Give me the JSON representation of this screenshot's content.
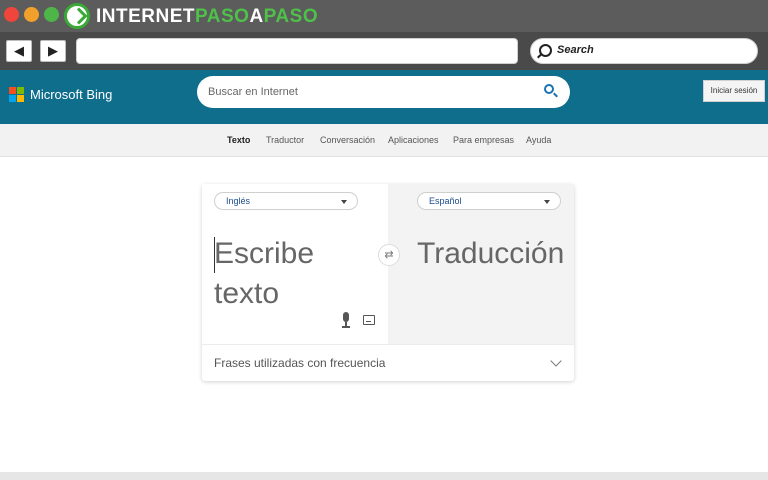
{
  "chrome": {
    "brand_prefix": "INTERNET",
    "brand_accent": "PASO",
    "brand_connector": "A",
    "brand_suffix": "PASO",
    "back_glyph": "◀",
    "forward_glyph": "▶",
    "address_value": "",
    "search_label": "Search",
    "colors": {
      "close": "#f0453a",
      "minimize": "#f2a02c",
      "maximize": "#4eb649",
      "brand_green": "#4fc04a"
    }
  },
  "bing": {
    "title": "Microsoft Bing",
    "search_placeholder": "Buscar en Internet",
    "signin_label": "Iniciar sesión",
    "header_color": "#0f6e8c"
  },
  "subnav": {
    "items": [
      {
        "label": "Texto",
        "active": true
      },
      {
        "label": "Traductor",
        "active": false
      },
      {
        "label": "Conversación",
        "active": false
      },
      {
        "label": "Aplicaciones",
        "active": false
      },
      {
        "label": "Para empresas",
        "active": false
      },
      {
        "label": "Ayuda",
        "active": false
      }
    ]
  },
  "translator": {
    "source_language": "Inglés",
    "target_language": "Español",
    "source_placeholder": "Escribe texto",
    "target_placeholder": "Traducción",
    "swap_glyph": "⇄",
    "phrases_label": "Frases utilizadas con frecuencia"
  },
  "icons": [
    "microsoft-logo-icon",
    "search-icon",
    "swap-icon",
    "microphone-icon",
    "keyboard-icon",
    "chevron-down-icon"
  ]
}
